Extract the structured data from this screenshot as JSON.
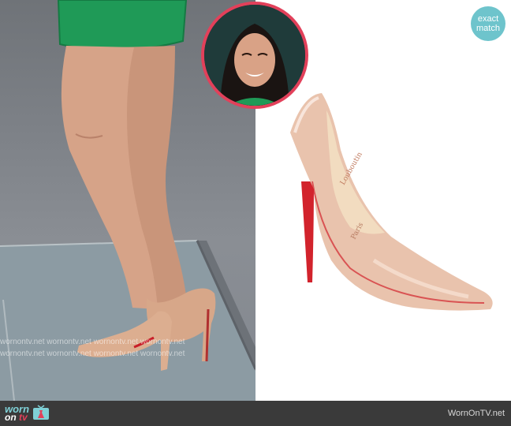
{
  "badge": {
    "line1": "exact",
    "line2": "match",
    "color": "#6ec4cc"
  },
  "watermark": {
    "line1": "wornontv.net  wornontv.net  wornontv.net  wornontv.net",
    "line2": "wornontv.net  wornontv.net  wornontv.net  wornontv.net"
  },
  "footer": {
    "logo_top": "worn",
    "logo_bottom_prefix": "on ",
    "logo_bottom_accent": "tv",
    "site_name": "WornOnTV.net"
  },
  "product": {
    "brand_marking": "Paris"
  },
  "colors": {
    "accent_pink": "#e2405a",
    "accent_teal": "#6ec4cc",
    "shoe_nude": "#e9c3ad",
    "sole_red": "#d2232c",
    "skirt_green": "#1f9a57"
  }
}
